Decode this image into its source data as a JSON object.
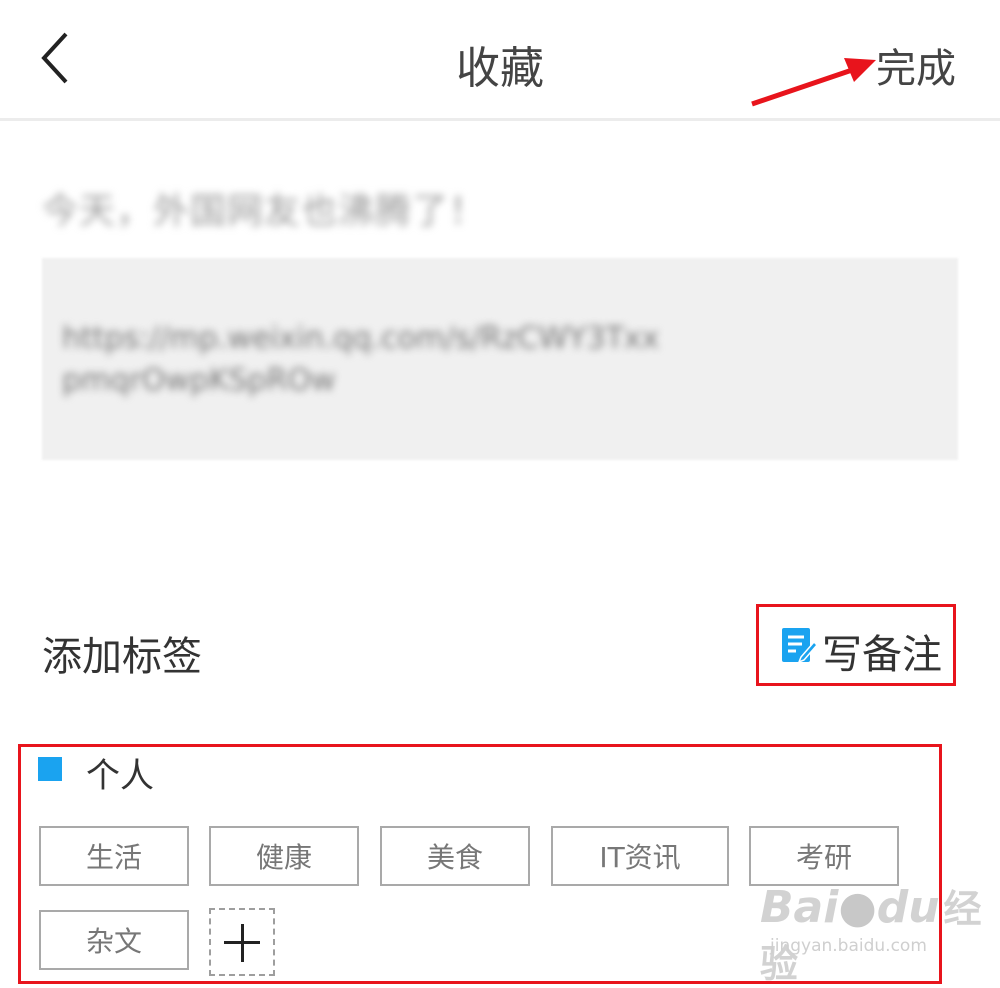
{
  "header": {
    "title": "收藏",
    "done_label": "完成"
  },
  "content": {
    "title": "今天，外国网友也沸腾了！",
    "link": "https://mp.weixin.qq.com/s/RzCWY3TxxpmqrOwpKSpROw"
  },
  "tags_section": {
    "label": "添加标签",
    "note_label": "写备注"
  },
  "tag_group": {
    "name": "个人",
    "tags": [
      "生活",
      "健康",
      "美食",
      "IT资讯",
      "考研",
      "杂文"
    ]
  },
  "watermark": {
    "brand": "Bai",
    "brand2": "du",
    "brand_cn": "经验",
    "url": "jingyan.baidu.com"
  },
  "colors": {
    "accent_blue": "#1aa3f0",
    "highlight_red": "#e8141c"
  },
  "icons": {
    "back": "chevron-left-icon",
    "note": "edit-note-icon",
    "add": "plus-icon"
  }
}
